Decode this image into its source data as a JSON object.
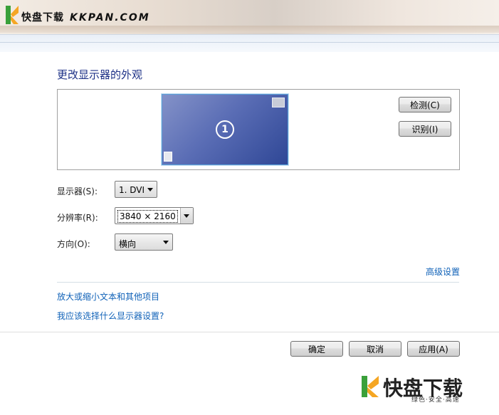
{
  "watermark": {
    "cn": "快盘下载",
    "en": "KKPAN.COM"
  },
  "page": {
    "title": "更改显示器的外观"
  },
  "preview": {
    "monitor_number": "1"
  },
  "buttons": {
    "detect": "检测(C)",
    "identify": "识别(I)",
    "ok": "确定",
    "cancel": "取消",
    "apply": "应用(A)"
  },
  "fields": {
    "display": {
      "label": "显示器(S):",
      "value": "1. DVI"
    },
    "resolution": {
      "label": "分辨率(R):",
      "value": "3840 × 2160"
    },
    "orientation": {
      "label": "方向(O):",
      "value": "横向"
    }
  },
  "links": {
    "advanced": "高级设置",
    "text_size": "放大或缩小文本和其他项目",
    "which_settings": "我应该选择什么显示器设置?"
  },
  "brand": {
    "name": "快盘下载",
    "slogan": "绿色·安全·高速"
  },
  "colors": {
    "title": "#1e3287",
    "link": "#1062b8",
    "brand_accent": "#f5a623"
  }
}
